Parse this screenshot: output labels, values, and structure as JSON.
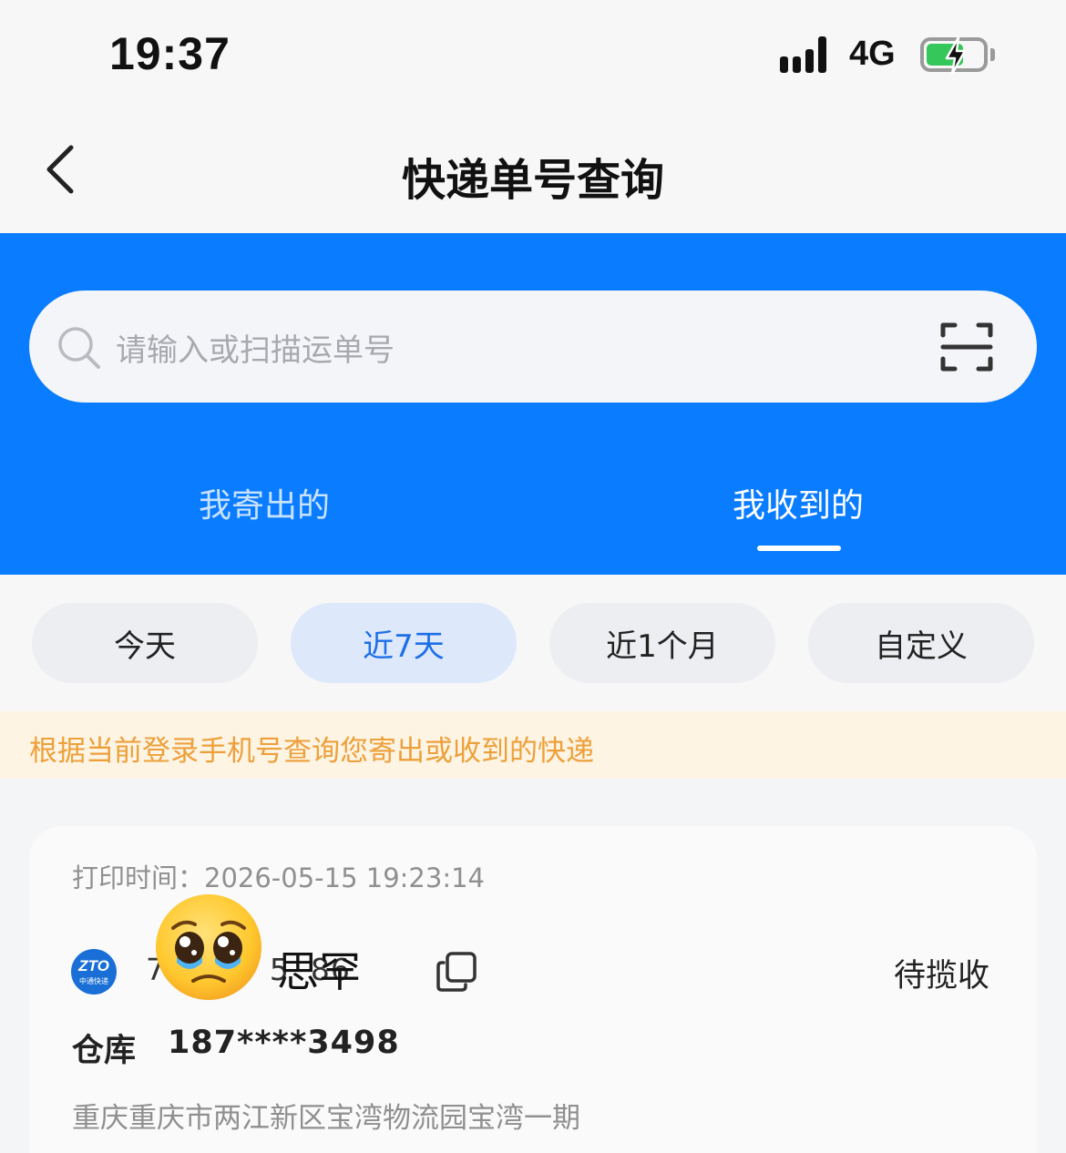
{
  "status_bar": {
    "time": "19:37",
    "network": "4G",
    "battery_level": 0.6,
    "battery_charging": true,
    "icons": [
      "signal-icon",
      "battery-icon"
    ]
  },
  "nav": {
    "back_icon": "chevron-left-icon",
    "title": "快递单号查询"
  },
  "search": {
    "placeholder": "请输入或扫描运单号",
    "search_icon": "search-icon",
    "scan_icon": "scan-icon"
  },
  "tabs": [
    {
      "label": "我寄出的",
      "active": false
    },
    {
      "label": "我收到的",
      "active": true
    }
  ],
  "filters": [
    {
      "label": "今天",
      "active": false
    },
    {
      "label": "近7天",
      "active": true
    },
    {
      "label": "近1个月",
      "active": false
    },
    {
      "label": "自定义",
      "active": false
    }
  ],
  "notice": "根据当前登录手机号查询您寄出或收到的快递",
  "package": {
    "print_time": "打印时间：2026-05-15 19:23:14",
    "carrier_logo": {
      "abbr": "ZTO",
      "name": "中通快递"
    },
    "tracking_number": "7     7   5  86",
    "sticker_text": "思罕",
    "copy_icon": "copy-icon",
    "status": "待揽收",
    "recipient_name": "仓库",
    "recipient_phone": "187****3498",
    "address": "重庆重庆市两江新区宝湾物流园宝湾一期"
  },
  "colors": {
    "brand_blue": "#0a7cff",
    "notice_orange": "#eda03a",
    "active_chip_bg": "#dde9fb",
    "active_chip_text": "#1d6fe8"
  }
}
